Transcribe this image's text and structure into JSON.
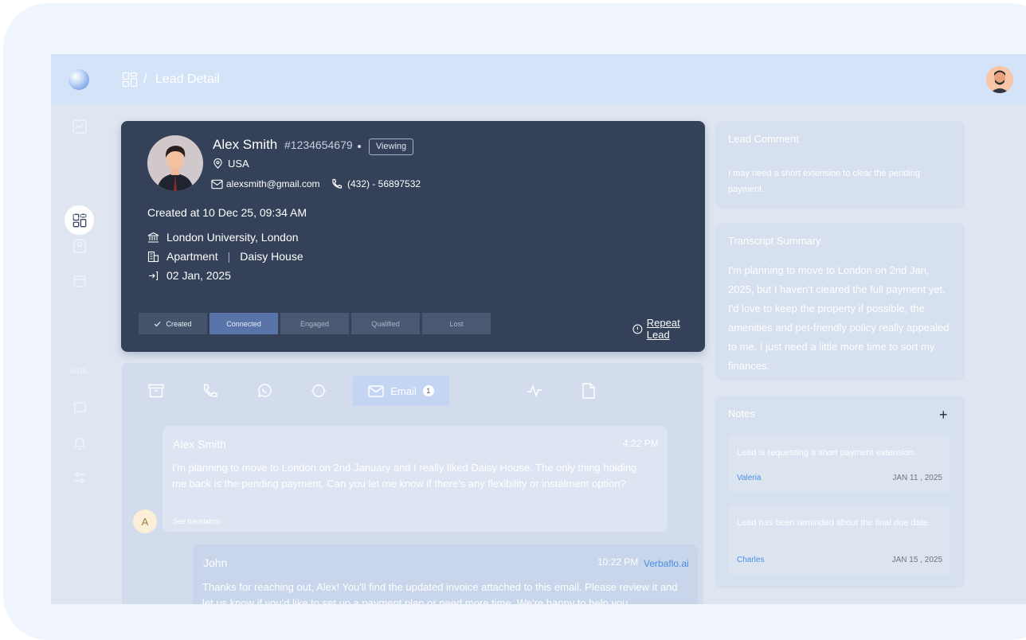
{
  "header": {
    "breadcrumb": "Lead Detail",
    "separator": "/"
  },
  "sidebar": {
    "text_item": "AIDS"
  },
  "lead": {
    "name": "Alex Smith",
    "id": "#1234654679",
    "status_tag": "Viewing",
    "country": "USA",
    "email": "alexsmith@gmail.com",
    "phone": "(432) - 56897532",
    "created_at": "Created at 10 Dec 25, 09:34 AM",
    "university": "London University, London",
    "property_type": "Apartment",
    "property_name": "Daisy House",
    "move_in_date": "02 Jan, 2025",
    "stages": [
      "Created",
      "Connected",
      "Engaged",
      "Qualified",
      "Lost"
    ],
    "repeat_lead": "Repeat Lead"
  },
  "communication": {
    "email_tab": {
      "label": "Email",
      "badge": "1"
    },
    "messages": [
      {
        "sender": "Alex Smith",
        "time": "4:22 PM",
        "body": "I'm planning to move to London on 2nd January and I really liked Daisy House. The only thing holding me back is the pending payment. Can you let me know if there's any flexibility or instalment option?",
        "action": "See translation",
        "avatar_initial": "A"
      },
      {
        "sender": "John",
        "time": "10:22 PM",
        "source": "Verbaflo.ai",
        "body": "Thanks for reaching out, Alex! You'll find the updated invoice attached to this email. Please review it and let us know if you'd like to set up a payment plan or need more time. We're happy to help you."
      }
    ]
  },
  "lead_comment": {
    "title": "Lead Comment",
    "text": "I may need a short extension to clear the pending payment."
  },
  "transcript_summary": {
    "title": "Transcript Summary",
    "text": "I'm planning to move to London on 2nd Jan, 2025, but I haven't cleared the full payment yet. I'd love to keep the property if possible, the amenities and pet-friendly policy really appealed to me. I just need a little more time to sort my finances."
  },
  "notes": {
    "title": "Notes",
    "add": "+",
    "items": [
      {
        "text": "Lead is requesting a short payment extension.",
        "author": "Valeria",
        "date": "JAN 11 , 2025"
      },
      {
        "text": "Lead has been reminded about the final due date.",
        "author": "Charles",
        "date": "JAN 15 , 2025"
      }
    ]
  },
  "colors": {
    "lead_card": "#344158",
    "topbar": "#d5e3f8",
    "accent_blue": "#4a8de6",
    "active_stage": "#5874a8"
  }
}
